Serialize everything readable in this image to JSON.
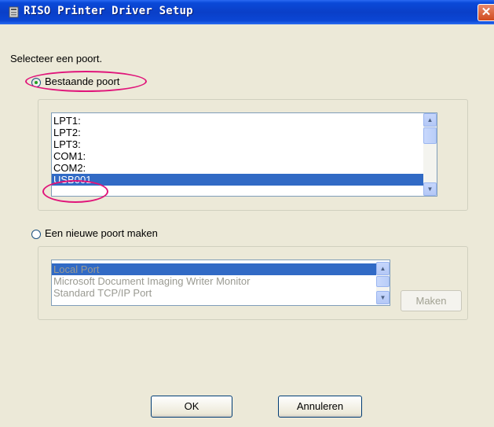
{
  "window": {
    "title": "RISO Printer Driver Setup",
    "close_glyph": "✕"
  },
  "instruction": "Selecteer een poort.",
  "existing_port": {
    "label": "Bestaande poort",
    "selected": true,
    "ports": [
      "LPT1:",
      "LPT2:",
      "LPT3:",
      "COM1:",
      "COM2:",
      "USB001"
    ],
    "selected_port": "USB001"
  },
  "new_port": {
    "label": "Een nieuwe poort maken",
    "selected": false,
    "port_types": [
      "Local Port",
      "Microsoft Document Imaging Writer Monitor",
      "Standard TCP/IP Port"
    ],
    "selected_type": "Local Port",
    "make_button": "Maken"
  },
  "buttons": {
    "ok": "OK",
    "cancel": "Annuleren"
  },
  "colors": {
    "highlight_annotation": "#e0157a",
    "selection": "#316ac5"
  }
}
